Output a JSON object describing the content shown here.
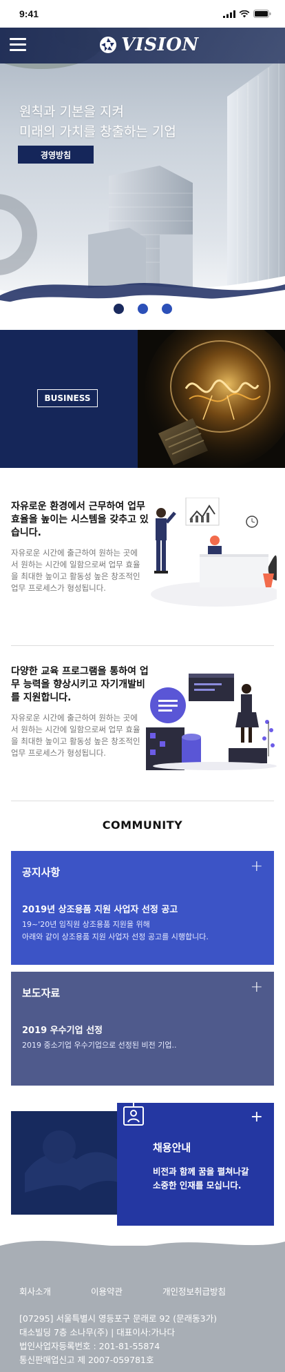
{
  "status_bar": {
    "time": "9:41"
  },
  "header": {
    "brand": "VISION"
  },
  "hero": {
    "headline_line1": "원칙과 기본을 지켜",
    "headline_line2": "미래의 가치를 창출하는 기업",
    "cta_label": "경영방침",
    "slide_count": 3,
    "active_slide": 1
  },
  "business": {
    "button_label": "BUSINESS"
  },
  "features": [
    {
      "title": "자유로운 환경에서 근무하여 업무효율을 높이는 시스템을 갖추고 있습니다.",
      "desc": "자유로운 시간에 출근하여 원하는 곳에서 원하는 시간에 일함으로써 업무 효율을 최대한 높이고 활동성 높은 창조적인 업무 프로세스가 형성됩니다."
    },
    {
      "title": "다양한 교육 프로그램을 통하여 업무 능력을 향상시키고 자기개발비를 지원합니다.",
      "desc": "자유로운 시간에 출근하여 원하는 곳에서 원하는 시간에 일함으로써 업무 효율을 최대한 높이고 활동성 높은 창조적인 업무 프로세스가 형성됩니다."
    }
  ],
  "community": {
    "title": "COMMUNITY",
    "notice": {
      "heading": "공지사항",
      "post_title": "2019년 상조용품 지원 사업자 선정 공고",
      "post_body_line1": "19~'20년 임직원 상조용품 지원을 위해",
      "post_body_line2": "아래와 같이 상조용품 지원 사업자 선정 공고를 시행합니다."
    },
    "press": {
      "heading": "보도자료",
      "post_title": "2019 우수기업 선정",
      "post_body": "2019 중소기업 우수기업으로 선정된 비전 기업.."
    },
    "recruit": {
      "heading": "채용안내",
      "body_line1": "비전과 함께 꿈을 펼쳐나갈",
      "body_line2": "소중한 인재를 모십니다."
    },
    "plus_symbol": "+"
  },
  "footer": {
    "links": [
      "회사소개",
      "이용약관",
      "개인정보취급방침"
    ],
    "address_line1": "[07295] 서울특별시 영등포구 문래로 92 (문래동3가)",
    "address_line2": "대소빌딩 7층 소나무(주) | 대표이사:가나다",
    "business_reg": "법인사업자등록번호 : 201-81-55874",
    "ecommerce_reg": "통신판매업신고 제 2007-059781호"
  },
  "colors": {
    "navy": "#152659",
    "blue": "#3c54c6",
    "slate": "#4f5a8c",
    "royal": "#2437a2",
    "footer": "#a8aeb5"
  }
}
